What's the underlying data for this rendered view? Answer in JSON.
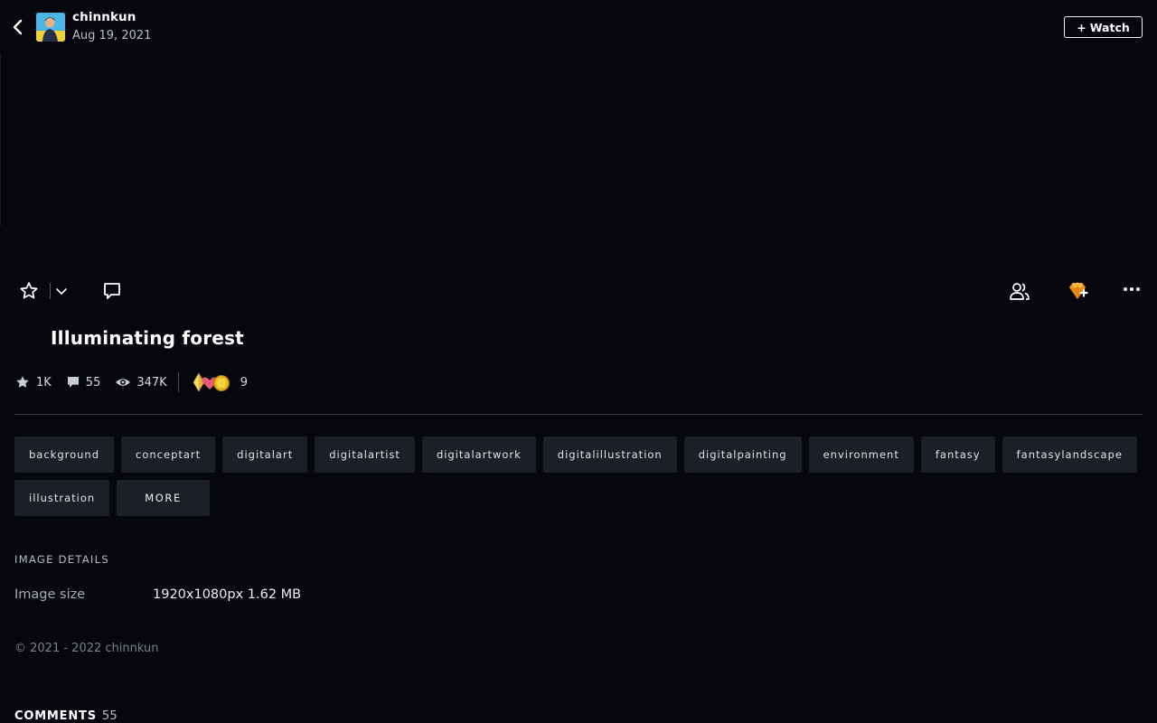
{
  "header": {
    "author": "chinnkun",
    "date": "Aug 19, 2021",
    "watch_label": "Watch",
    "watch_plus": "+"
  },
  "deviation": {
    "title": "Illuminating forest"
  },
  "stats": {
    "favourites": "1K",
    "comments": "55",
    "views": "347K",
    "awards": "9"
  },
  "tags": [
    "background",
    "conceptart",
    "digitalart",
    "digitalartist",
    "digitalartwork",
    "digitalillustration",
    "digitalpainting",
    "environment",
    "fantasy",
    "fantasylandscape",
    "illustration"
  ],
  "tags_more_label": "More",
  "details": {
    "heading": "Image details",
    "size_label": "Image size",
    "size_value": "1920x1080px 1.62 MB"
  },
  "copyright": "© 2021 - 2022 chinnkun",
  "comments_section": {
    "heading": "Comments",
    "count": "55"
  },
  "colors": {
    "background": "#06070d",
    "tag_background": "#1d1f27",
    "gift_accent": "#f7a21b"
  },
  "icons": {
    "back": "chevron-left-icon",
    "favourite": "star-icon",
    "favourite_more": "chevron-down-icon",
    "comment": "speech-bubble-icon",
    "groups": "people-icon",
    "gift": "gem-gift-icon",
    "more": "ellipsis-icon",
    "views": "eye-icon"
  }
}
